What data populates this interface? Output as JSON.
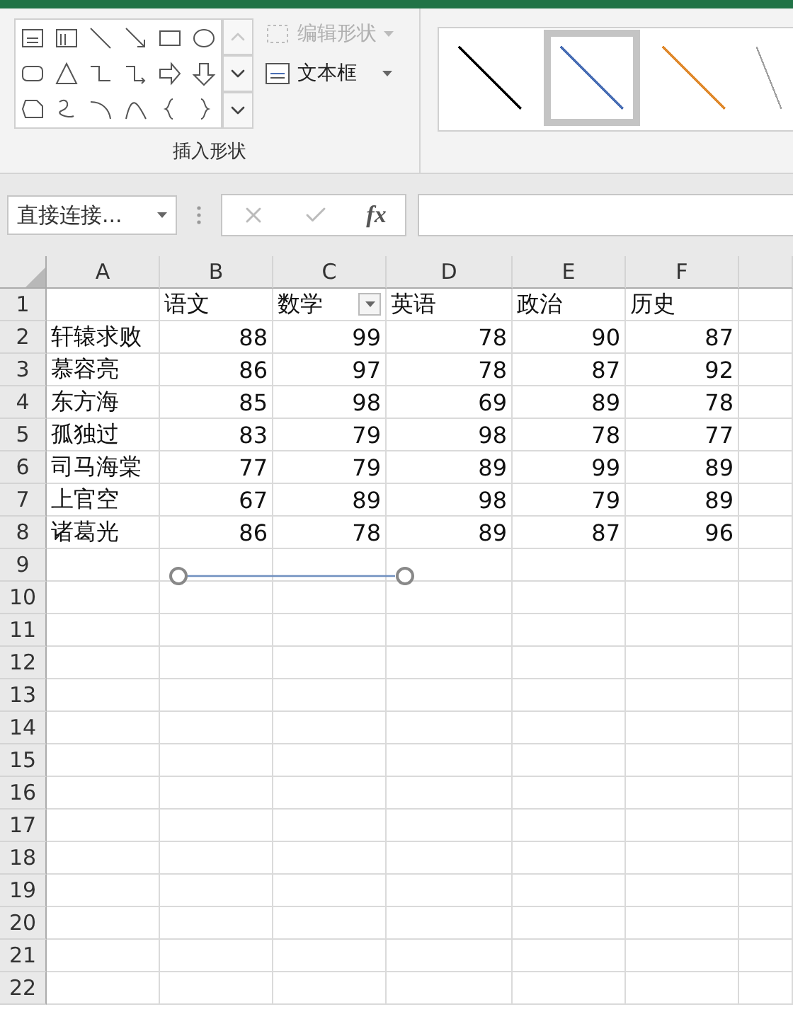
{
  "ribbon": {
    "edit_shape": {
      "label": "编辑形状",
      "disabled": true
    },
    "text_box": {
      "label": "文本框"
    },
    "group_label": "插入形状",
    "line_styles": [
      {
        "color": "#000000",
        "selected": false
      },
      {
        "color": "#4a6fb5",
        "selected": true
      },
      {
        "color": "#e08a2e",
        "selected": false
      },
      {
        "color": "#a0a0a0",
        "selected": false
      }
    ]
  },
  "formula_bar": {
    "name_box": "直接连接...",
    "function_label": "fx"
  },
  "sheet": {
    "columns": [
      "A",
      "B",
      "C",
      "D",
      "E",
      "F"
    ],
    "header_row": {
      "number": "1",
      "labels": [
        {
          "text": "语文",
          "filter": false
        },
        {
          "text": "数学",
          "filter": true
        },
        {
          "text": "英语",
          "filter": false
        },
        {
          "text": "政治",
          "filter": false
        },
        {
          "text": "历史",
          "filter": false
        }
      ]
    },
    "rows": [
      {
        "number": "2",
        "name": "轩辕求败",
        "scores": [
          "88",
          "99",
          "78",
          "90",
          "87"
        ]
      },
      {
        "number": "3",
        "name": "慕容亮",
        "scores": [
          "86",
          "97",
          "78",
          "87",
          "92"
        ]
      },
      {
        "number": "4",
        "name": "东方海",
        "scores": [
          "85",
          "98",
          "69",
          "89",
          "78"
        ]
      },
      {
        "number": "5",
        "name": "孤独过",
        "scores": [
          "83",
          "79",
          "98",
          "78",
          "77"
        ]
      },
      {
        "number": "6",
        "name": "司马海棠",
        "scores": [
          "77",
          "79",
          "89",
          "99",
          "89"
        ]
      },
      {
        "number": "7",
        "name": "上官空",
        "scores": [
          "67",
          "89",
          "98",
          "79",
          "89"
        ]
      },
      {
        "number": "8",
        "name": "诸葛光",
        "scores": [
          "86",
          "78",
          "89",
          "87",
          "96"
        ]
      }
    ],
    "empty_rows": [
      "9",
      "10",
      "11",
      "12",
      "13",
      "14",
      "15",
      "16",
      "17",
      "18",
      "19",
      "20",
      "21",
      "22"
    ]
  }
}
